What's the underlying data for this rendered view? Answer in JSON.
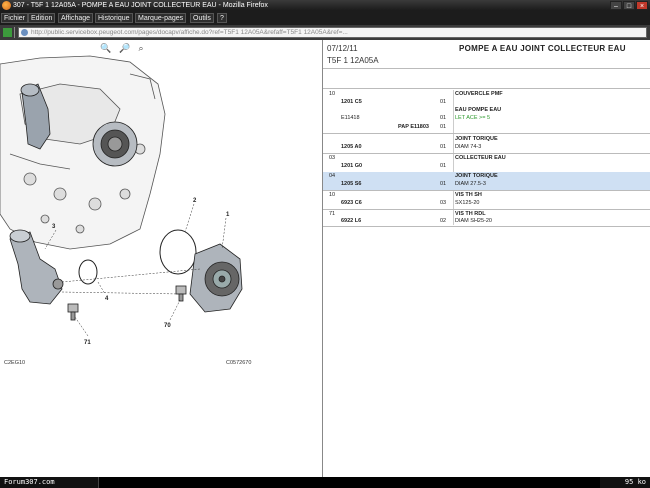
{
  "window": {
    "title": "307 - T5F 1 12A05A - POMPE A EAU JOINT COLLECTEUR EAU - Mozilla Firefox",
    "buttons": [
      "–",
      "□",
      "×"
    ]
  },
  "menu": [
    "Fichier",
    "Edition",
    "Affichage",
    "Historique",
    "Marque-pages",
    "Outils",
    "?"
  ],
  "address": {
    "url": "http://public.servicebox.peugeot.com/pages/docapv/affiche.do?ref=T5F1 12A05A&refaff=T5F1 12A05A&ref=..."
  },
  "diagram": {
    "callouts": [
      "1",
      "2",
      "3",
      "4",
      "70",
      "71"
    ],
    "ref_left": "C2EG10",
    "ref_right": "C0572670"
  },
  "parts": {
    "date": "07/12/11",
    "title": "POMPE A EAU JOINT COLLECTEUR EAU",
    "subtitle": "T5F 1 12A05A",
    "rows": [
      {
        "pos": "10",
        "ref": "1201 C5",
        "qty": "01",
        "desc1": "COUVERCLE PMF",
        "desc2": ""
      },
      {
        "pos": "",
        "ref": "E11418",
        "qty": "01",
        "desc1": "EAU POMPE EAU",
        "desc2": "LET ACE >= 5",
        "note2": "PAP E11803",
        "qty3": "01"
      },
      {
        "pos": "",
        "ref": "1205 A0",
        "qty": "01",
        "desc1": "JOINT TORIQUE",
        "desc2": "DIAM 74-3"
      },
      {
        "pos": "03",
        "ref": "1201 G0",
        "qty": "01",
        "desc1": "COLLECTEUR EAU",
        "desc2": ""
      },
      {
        "pos": "04",
        "ref": "1205 S6",
        "qty": "01",
        "desc1": "JOINT TORIQUE",
        "desc2": "DIAM 27.5-3"
      },
      {
        "pos": "10",
        "ref": "6923 C6",
        "qty": "03",
        "desc1": "VIS TH SH",
        "desc2": "SX125-20"
      },
      {
        "pos": "71",
        "ref": "6922 L6",
        "qty": "02",
        "desc1": "VIS TH RDL",
        "desc2": "DIAM SH25-20"
      }
    ]
  },
  "status": {
    "site": "Forum307.com",
    "size": "95 ko"
  }
}
